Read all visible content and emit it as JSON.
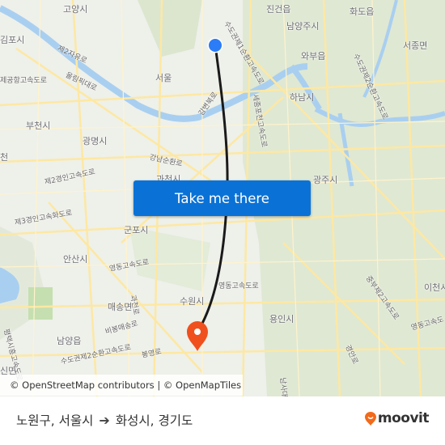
{
  "map": {
    "place_labels": [
      {
        "id": "goyang",
        "text": "고양시"
      },
      {
        "id": "gimpo",
        "text": "김포시"
      },
      {
        "id": "seoul",
        "text": "서울"
      },
      {
        "id": "bucheon",
        "text": "부천시"
      },
      {
        "id": "gwangmyeong",
        "text": "광명시"
      },
      {
        "id": "jingeon",
        "text": "진건읍"
      },
      {
        "id": "namyangju",
        "text": "남양주시"
      },
      {
        "id": "hwado",
        "text": "화도읍"
      },
      {
        "id": "seojong",
        "text": "서종면"
      },
      {
        "id": "wabu",
        "text": "와부읍"
      },
      {
        "id": "hanam",
        "text": "하남시"
      },
      {
        "id": "gwacheon",
        "text": "과천시"
      },
      {
        "id": "gunpo",
        "text": "군포시"
      },
      {
        "id": "ansan",
        "text": "안산시"
      },
      {
        "id": "maesong",
        "text": "매송면"
      },
      {
        "id": "namyang",
        "text": "남양읍"
      },
      {
        "id": "suwon",
        "text": "수원시"
      },
      {
        "id": "yongin",
        "text": "용인시"
      },
      {
        "id": "gwangju",
        "text": "광주시"
      },
      {
        "id": "icheon",
        "text": "이천시"
      },
      {
        "id": "incheon",
        "text": "천"
      },
      {
        "id": "sinmyeon",
        "text": "신면"
      }
    ],
    "road_labels": [
      {
        "id": "jayu",
        "text": "제2자유로"
      },
      {
        "id": "olympic",
        "text": "올림픽대로"
      },
      {
        "id": "airport",
        "text": "제공항고속도로"
      },
      {
        "id": "gangbyeon",
        "text": "강변북로"
      },
      {
        "id": "gangnam",
        "text": "강남순환로"
      },
      {
        "id": "sejong",
        "text": "세종포천고속도로"
      },
      {
        "id": "gyeongin2",
        "text": "제2경인고속도로"
      },
      {
        "id": "gyeongin3",
        "text": "제3경인고속화도로"
      },
      {
        "id": "yeongdong",
        "text": "영동고속도로"
      },
      {
        "id": "yeongdong2",
        "text": "영동고속도로"
      },
      {
        "id": "yeongdong3",
        "text": "영동고속도"
      },
      {
        "id": "gwacheon",
        "text": "과천로"
      },
      {
        "id": "bibong",
        "text": "비봉매송로"
      },
      {
        "id": "sudogwon",
        "text": "수도권제2순환고속도로"
      },
      {
        "id": "bongyeong",
        "text": "봉영로"
      },
      {
        "id": "pyeongtaek",
        "text": "평택시흥고속도로"
      },
      {
        "id": "sudogwon1",
        "text": "수도권제1순환고속도로"
      },
      {
        "id": "sudogwon2e",
        "text": "수도권제2순환고속도로"
      },
      {
        "id": "jungbu2",
        "text": "중부제2고속도로"
      },
      {
        "id": "namsa",
        "text": "남사대로"
      },
      {
        "id": "gyeongan",
        "text": "경안로"
      }
    ],
    "origin": {
      "name": "노원구, 서울시",
      "color": "#2b7cf6"
    },
    "destination": {
      "name": "화성시, 경기도",
      "color": "#f0501e"
    },
    "route_color": "#1a1a1a",
    "attribution": "© OpenStreetMap contributors | © OpenMapTiles"
  },
  "cta": {
    "label": "Take me there",
    "color": "#0a72d6"
  },
  "footer": {
    "origin": "노원구, 서울시",
    "arrow_icon": "arrow-right-icon",
    "destination": "화성시, 경기도",
    "logo_text": "moovit",
    "logo_color": "#f26a1b"
  }
}
